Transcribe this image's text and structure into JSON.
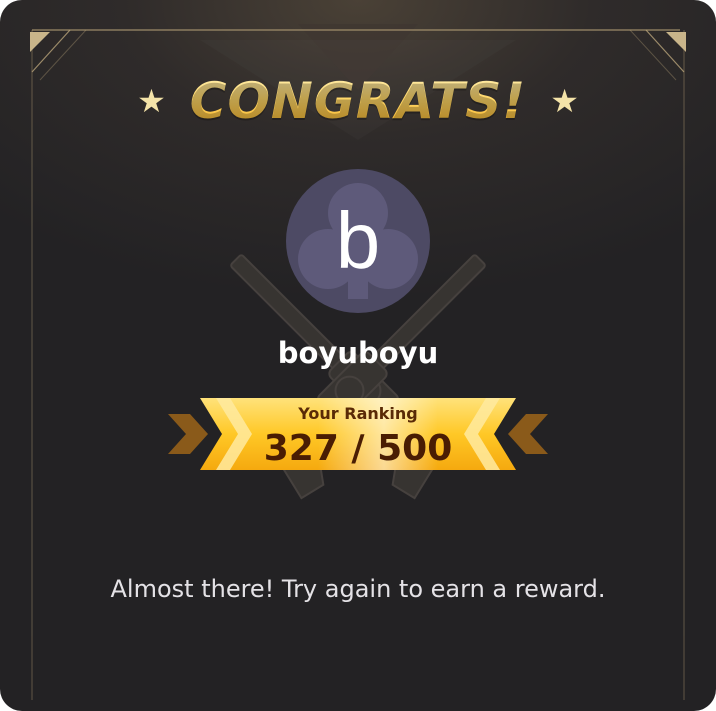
{
  "result": {
    "title": "CONGRATS!",
    "star_left": "★",
    "star_right": "★",
    "avatar_letter": "b",
    "avatar_icon": "club-icon",
    "background_icon": "crossed-revolvers-icon",
    "username": "boyuboyu",
    "ranking_label": "Your Ranking",
    "ranking_value": "327 / 500",
    "rank": 327,
    "total": 500,
    "message": "Almost there! Try again to earn a reward."
  },
  "colors": {
    "title_gold": "#ffd86a",
    "banner_gold": "#ffc826",
    "ranking_text": "#4a1d03",
    "avatar_bg": "#4d4a64",
    "frame_line": "#b9a47a"
  }
}
